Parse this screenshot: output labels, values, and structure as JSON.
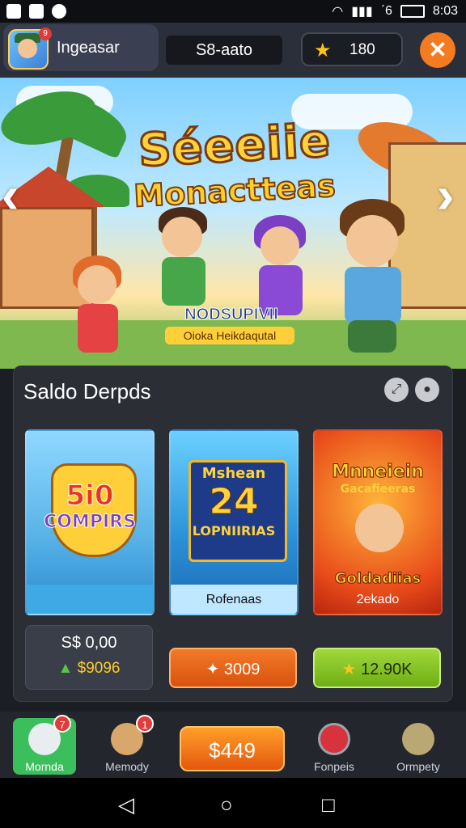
{
  "status_bar": {
    "signal_text": "ˊ6",
    "time": "8:03"
  },
  "top_bar": {
    "profile_name": "Ingeasar",
    "avatar_badge": "9",
    "center_label": "S8-aato",
    "coin_value": "180",
    "close_symbol": "✕"
  },
  "hero": {
    "title_line1": "Séeeiie",
    "title_line2": "Monactteas",
    "subtitle": "NODSUPIVII",
    "tagline": "Oioka Heikdaqutal",
    "prev_arrow": "‹",
    "next_arrow": "›"
  },
  "panel": {
    "title": "Saldo Derpds",
    "icons": [
      "link-icon",
      "info-icon"
    ],
    "cards": [
      {
        "art_line1": "5i0",
        "art_line2": "COMPIRS",
        "caption": ""
      },
      {
        "art_line1": "Mshean",
        "art_line2": "24",
        "art_line3": "LOPNIIRIAS",
        "caption": "Rofenaas"
      },
      {
        "art_line1": "Mnneiein",
        "art_line2": "Gacafieeras",
        "art_line3": "Goldadiias",
        "caption": "2ekado"
      }
    ],
    "price_box": {
      "line1": "S$ 0,00",
      "line2": "$9096"
    },
    "buy_buttons": [
      {
        "label": "3009",
        "icon": "gem-icon"
      },
      {
        "label": "12.90K",
        "icon": "star-icon"
      }
    ]
  },
  "bottom_nav": {
    "items": [
      {
        "label": "Mornda",
        "badge": "7",
        "icon": "chat-icon"
      },
      {
        "label": "Memody",
        "badge": "1",
        "icon": "avatar-icon"
      },
      {
        "label": "Fonpeis",
        "badge": "",
        "icon": "medal-icon"
      },
      {
        "label": "Ormpety",
        "badge": "",
        "icon": "trophy-icon"
      }
    ],
    "cta_label": "$449"
  },
  "colors": {
    "accent_orange": "#f47b1f",
    "panel_bg": "#2b2e35",
    "buy_orange": "#e9621b",
    "buy_green": "#86c322"
  }
}
